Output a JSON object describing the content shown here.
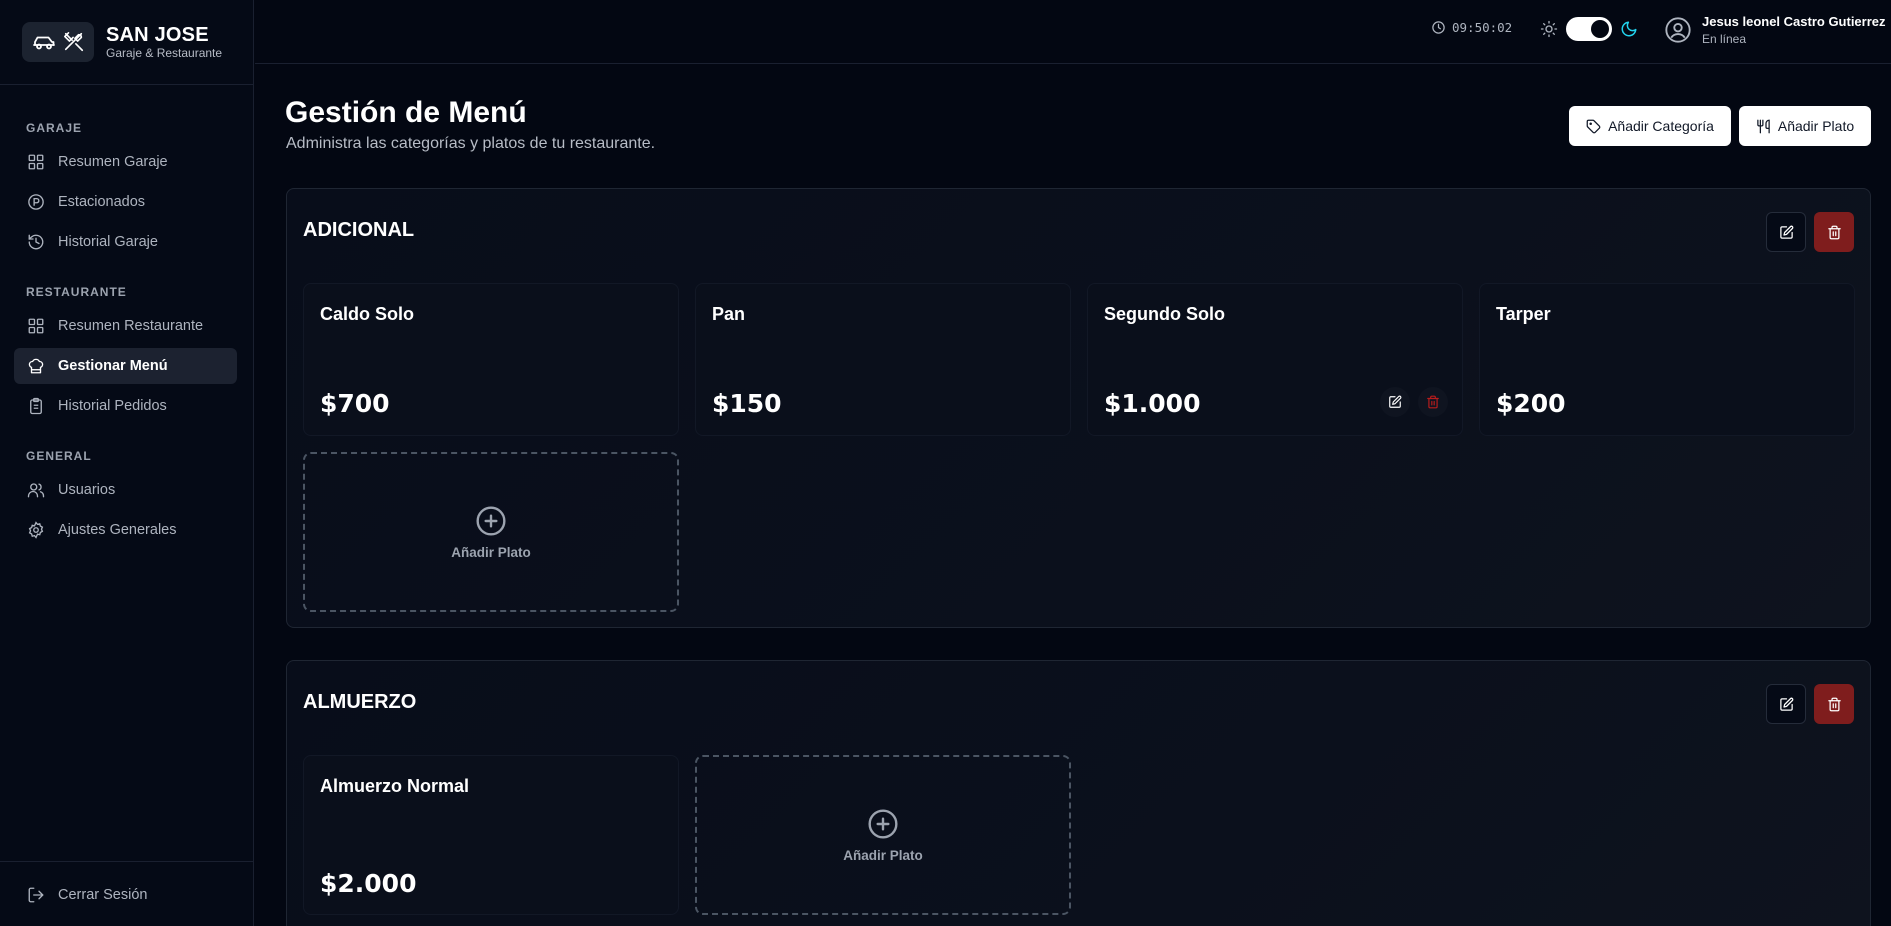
{
  "brand": {
    "title": "SAN JOSE",
    "subtitle": "Garaje & Restaurante"
  },
  "sidebar": {
    "sections": [
      {
        "title": "GARAJE",
        "items": [
          {
            "label": "Resumen Garaje",
            "icon": "grid-icon"
          },
          {
            "label": "Estacionados",
            "icon": "parking-icon"
          },
          {
            "label": "Historial Garaje",
            "icon": "history-icon"
          }
        ]
      },
      {
        "title": "RESTAURANTE",
        "items": [
          {
            "label": "Resumen Restaurante",
            "icon": "grid-icon"
          },
          {
            "label": "Gestionar Menú",
            "icon": "chef-hat-icon",
            "active": true
          },
          {
            "label": "Historial Pedidos",
            "icon": "clipboard-icon"
          }
        ]
      },
      {
        "title": "GENERAL",
        "items": [
          {
            "label": "Usuarios",
            "icon": "users-icon"
          },
          {
            "label": "Ajustes Generales",
            "icon": "gear-icon"
          }
        ]
      }
    ],
    "logout_label": "Cerrar Sesión"
  },
  "topbar": {
    "time": "09:50:02",
    "theme": "dark",
    "user_name": "Jesus leonel Castro Gutierrez",
    "user_status": "En línea"
  },
  "page": {
    "title": "Gestión de Menú",
    "subtitle": "Administra las categorías y platos de tu restaurante.",
    "add_category_label": "Añadir Categoría",
    "add_dish_label": "Añadir Plato"
  },
  "categories": [
    {
      "name": "ADICIONAL",
      "dishes": [
        {
          "name": "Caldo Solo",
          "price": "$700"
        },
        {
          "name": "Pan",
          "price": "$150"
        },
        {
          "name": "Segundo Solo",
          "price": "$1.000"
        },
        {
          "name": "Tarper",
          "price": "$200"
        }
      ],
      "add_label": "Añadir Plato"
    },
    {
      "name": "ALMUERZO",
      "dishes": [
        {
          "name": "Almuerzo Normal",
          "price": "$2.000"
        }
      ],
      "add_label": "Añadir Plato"
    }
  ],
  "colors": {
    "background": "#030712",
    "danger": "#7f1d1d",
    "accent": "#22d3ee"
  }
}
